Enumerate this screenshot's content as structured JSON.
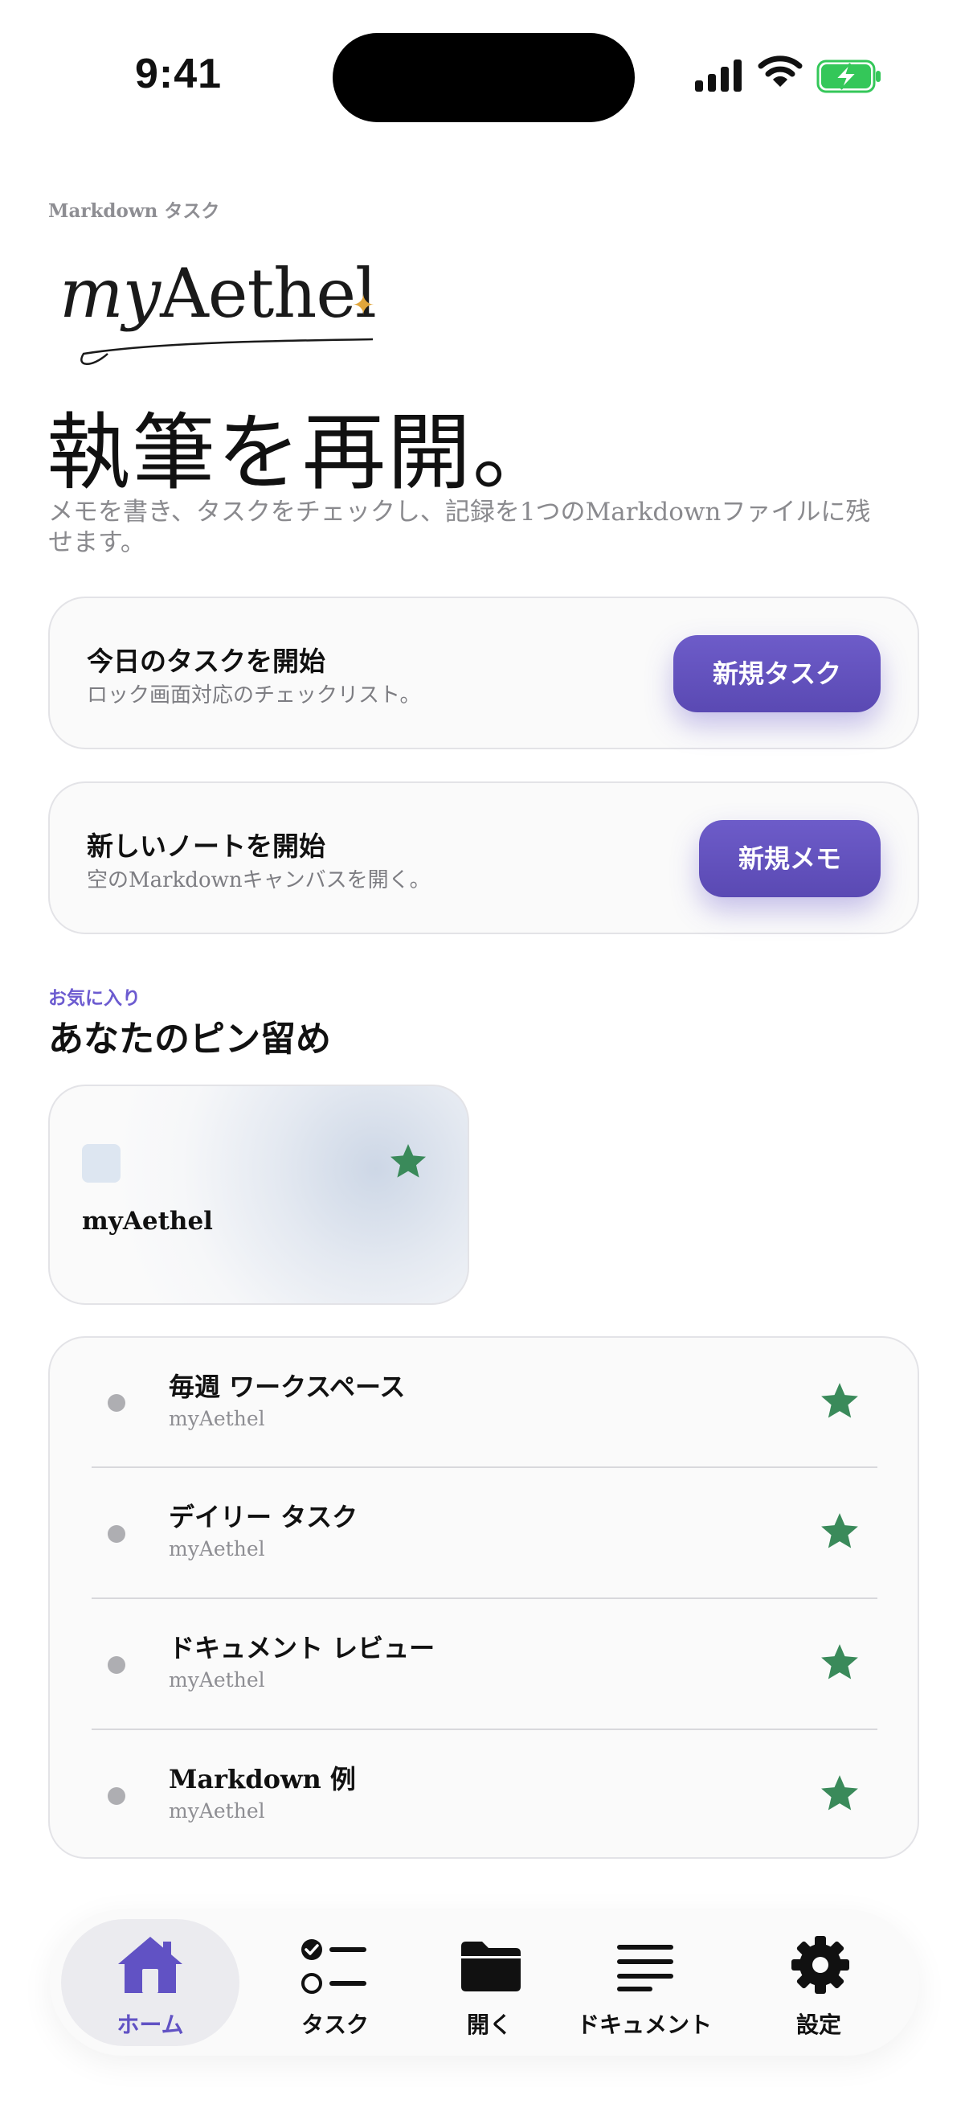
{
  "status": {
    "time": "9:41"
  },
  "header": {
    "eyebrow": "Markdown タスク",
    "logo_text_my": "my",
    "logo_text_rest": "Aethel",
    "hero_title": "執筆を再開。",
    "hero_subtitle": "メモを書き、タスクをチェックし、記録を1つのMarkdownファイルに残せます。"
  },
  "cards": [
    {
      "title": "今日のタスクを開始",
      "subtitle": "ロック画面対応のチェックリスト。",
      "button": "新規タスク"
    },
    {
      "title": "新しいノートを開始",
      "subtitle": "空のMarkdownキャンバスを開く。",
      "button": "新規メモ"
    }
  ],
  "favorites": {
    "eyebrow": "お気に入り",
    "title": "あなたのピン留め",
    "pinned_card": {
      "label": "myAethel"
    },
    "items": [
      {
        "title": "毎週 ワークスペース",
        "subtitle": "myAethel"
      },
      {
        "title": "デイリー タスク",
        "subtitle": "myAethel"
      },
      {
        "title": "ドキュメント レビュー",
        "subtitle": "myAethel"
      },
      {
        "title": "Markdown 例",
        "subtitle": "myAethel"
      }
    ]
  },
  "tabbar": {
    "items": [
      {
        "label": "ホーム",
        "icon": "house-icon",
        "active": true
      },
      {
        "label": "タスク",
        "icon": "checklist-icon"
      },
      {
        "label": "開く",
        "icon": "folder-icon"
      },
      {
        "label": "ドキュメント",
        "icon": "document-lines-icon"
      },
      {
        "label": "設定",
        "icon": "gear-icon"
      }
    ]
  },
  "colors": {
    "accent": "#5f4fbf",
    "star": "#3a8a5a",
    "logo_sparkle": "#e0a53b",
    "battery": "#34c759"
  }
}
